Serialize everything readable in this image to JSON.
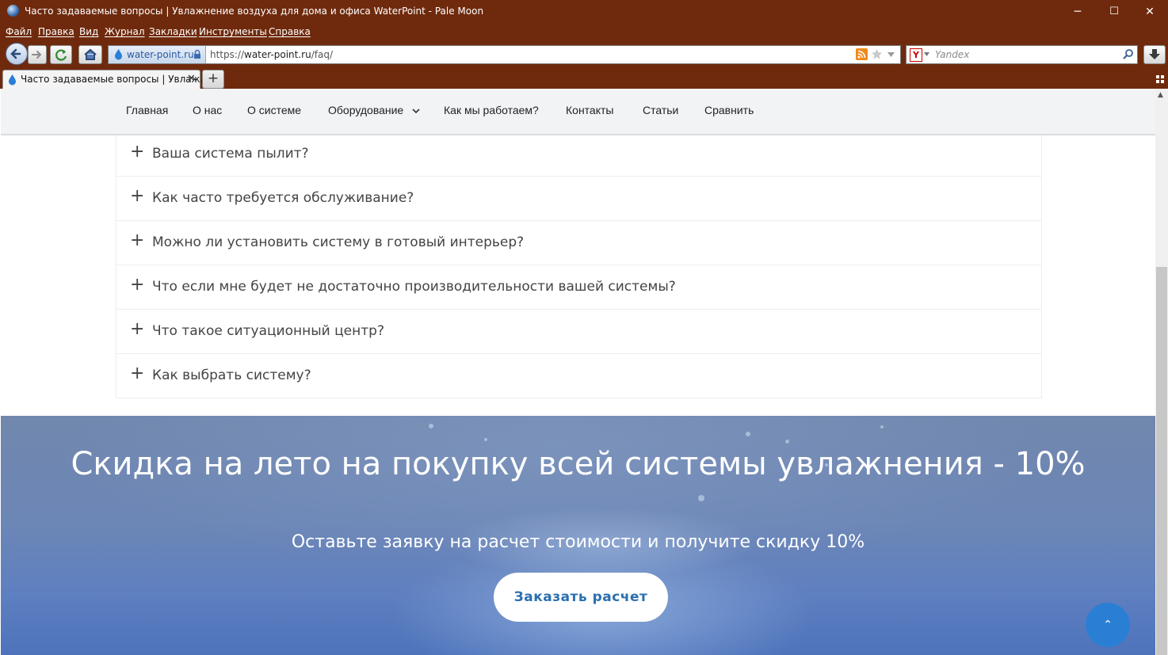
{
  "window": {
    "title": "Часто задаваемые вопросы | Увлажнение воздуха для дома и офиса WaterPoint - Pale Moon",
    "minimize": "─",
    "maximize": "☐",
    "close": "✕"
  },
  "menu": [
    "Файл",
    "Правка",
    "Вид",
    "Журнал",
    "Закладки",
    "Инструменты",
    "Справка"
  ],
  "toolbar": {
    "site_identity": "water-point.ru",
    "url_prefix": "https://",
    "url_host": "water-point.ru",
    "url_path": "/faq/",
    "search_placeholder": "Yandex",
    "search_engine_icon": "Y"
  },
  "tabs": [
    {
      "label": "Часто задаваемые вопросы | Увлаж...",
      "close": "✕"
    }
  ],
  "new_tab": "+",
  "site_nav": [
    "Главная",
    "О нас",
    "О системе",
    "Оборудование",
    "Как мы работаем?",
    "Контакты",
    "Статьи",
    "Сравнить"
  ],
  "faq": [
    "Ваша система пылит?",
    "Как часто требуется обслуживание?",
    "Можно ли установить систему в готовый интерьер?",
    "Что если мне будет не достаточно производительности вашей системы?",
    "Что такое ситуационный центр?",
    "Как выбрать систему?"
  ],
  "promo": {
    "title": "Скидка на лето на покупку всей системы увлажнения - 10%",
    "subtitle": "Оставьте заявку на расчет стоимости и получите скидку 10%",
    "button": "Заказать расчет"
  },
  "scroll_top": "⌃",
  "colors": {
    "chrome": "#6f2a0d",
    "accent": "#2a7fd4",
    "promo_bg": "#5e7fc0"
  }
}
